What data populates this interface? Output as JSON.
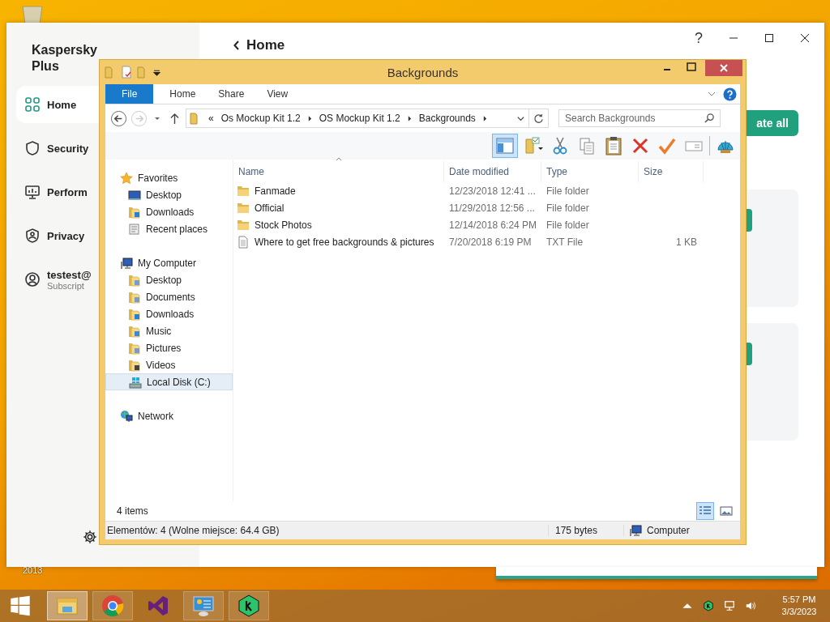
{
  "desktop": {
    "icon_labels": [
      "2013"
    ]
  },
  "kaspersky": {
    "title": "Kaspersky Plus",
    "help": "?",
    "page_title": "Home",
    "action_button": "ate all",
    "nav": [
      {
        "label": "Home",
        "selected": true
      },
      {
        "label": "Security",
        "selected": false
      },
      {
        "label": "Perform",
        "selected": false
      },
      {
        "label": "Privacy",
        "selected": false
      },
      {
        "label": "testest@",
        "sublabel": "Subscript",
        "selected": false
      }
    ]
  },
  "explorer": {
    "title": "Backgrounds",
    "ribbon_tabs": [
      {
        "label": "File",
        "kind": "menu"
      },
      {
        "label": "Home",
        "kind": "tab"
      },
      {
        "label": "Share",
        "kind": "tab"
      },
      {
        "label": "View",
        "kind": "tab"
      }
    ],
    "address": {
      "overflow": "«",
      "crumbs": [
        "Os Mockup Kit 1.2",
        "OS Mockup Kit 1.2",
        "Backgrounds"
      ]
    },
    "search": {
      "placeholder": "Search Backgrounds"
    },
    "toolbar": [
      {
        "selected": true
      },
      {
        "selected": false
      },
      {
        "selected": false
      },
      {
        "selected": false
      },
      {
        "selected": false
      },
      {
        "selected": false
      },
      {
        "selected": false
      },
      {
        "selected": false
      },
      {
        "selected": false
      }
    ],
    "nav": [
      {
        "label": "Favorites",
        "selected": false,
        "children": [
          {
            "label": "Desktop",
            "selected": false
          },
          {
            "label": "Downloads",
            "selected": false
          },
          {
            "label": "Recent places",
            "selected": false
          }
        ]
      },
      {
        "label": "My Computer",
        "selected": false,
        "children": [
          {
            "label": "Desktop",
            "selected": false
          },
          {
            "label": "Documents",
            "selected": false
          },
          {
            "label": "Downloads",
            "selected": false
          },
          {
            "label": "Music",
            "selected": false
          },
          {
            "label": "Pictures",
            "selected": false
          },
          {
            "label": "Videos",
            "selected": false
          },
          {
            "label": "Local Disk (C:)",
            "selected": true
          }
        ]
      },
      {
        "label": "Network",
        "selected": false
      }
    ],
    "columns": [
      "Name",
      "Date modified",
      "Type",
      "Size"
    ],
    "files": [
      {
        "kind": "folder",
        "name": "Fanmade",
        "date": "12/23/2018 12:41 ...",
        "type": "File folder"
      },
      {
        "kind": "folder",
        "name": "Official",
        "date": "11/29/2018 12:56 ...",
        "type": "File folder"
      },
      {
        "kind": "folder",
        "name": "Stock Photos",
        "date": "12/14/2018 6:24 PM",
        "type": "File folder"
      },
      {
        "kind": "text",
        "name": "Where to get free backgrounds & pictures",
        "date": "7/20/2018 6:19 PM",
        "type": "TXT File",
        "size": "1 KB"
      }
    ],
    "item_count": "4 items",
    "views": [
      {
        "selected": true
      },
      {
        "selected": false
      }
    ],
    "status": {
      "text": "Elementów: 4 (Wolne miejsce: 64.4 GB)",
      "size": "175 bytes",
      "location": "Computer"
    }
  },
  "taskbar": {
    "apps": [
      {
        "running": true,
        "selected": true
      },
      {
        "running": true,
        "selected": false
      },
      {
        "running": false,
        "selected": false
      },
      {
        "running": true,
        "selected": false
      },
      {
        "running": true,
        "selected": false
      }
    ],
    "time": "5:57 PM",
    "date": "3/3/2023"
  }
}
